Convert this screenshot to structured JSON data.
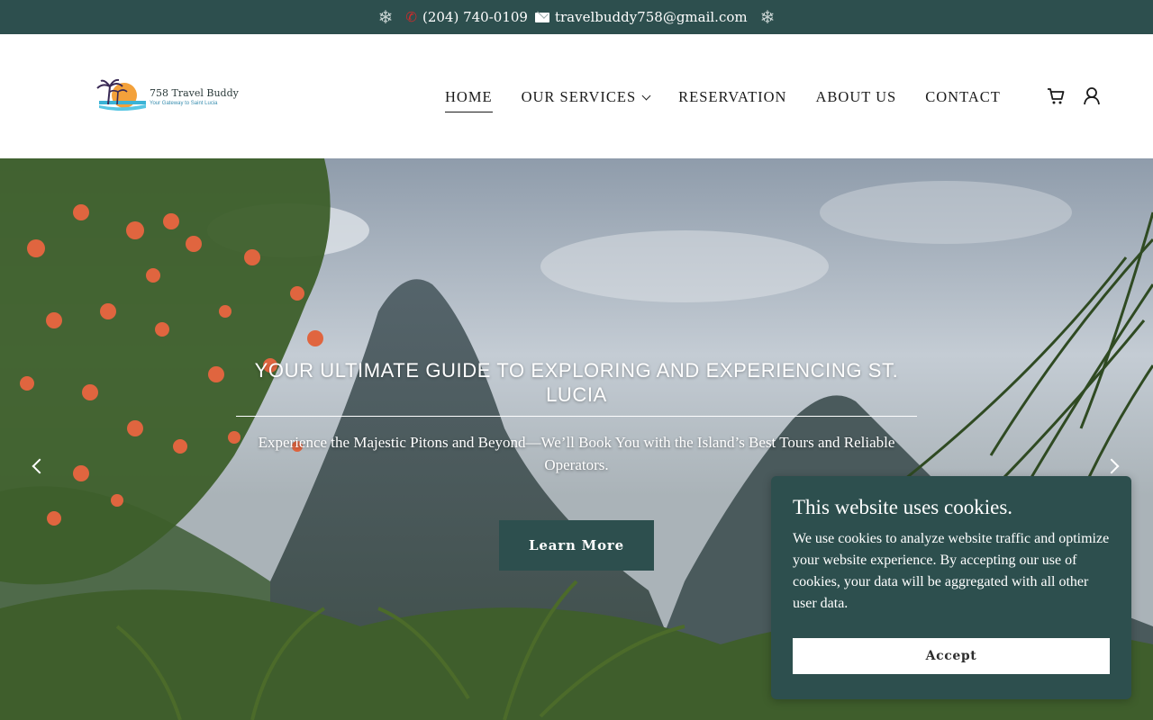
{
  "topbar": {
    "phone": "(204) 740-0109",
    "email": "travelbuddy758@gmail.com"
  },
  "logo": {
    "title": "758 Travel Buddy",
    "tagline": "Your Gateway to Saint Lucia"
  },
  "nav": {
    "items": [
      {
        "label": "HOME",
        "active": true
      },
      {
        "label": "OUR SERVICES",
        "dropdown": true
      },
      {
        "label": "RESERVATION"
      },
      {
        "label": "ABOUT US"
      },
      {
        "label": "CONTACT"
      }
    ],
    "icons": [
      "cart-icon",
      "user-icon"
    ]
  },
  "hero": {
    "title": "YOUR ULTIMATE GUIDE TO EXPLORING AND EXPERIENCING ST. LUCIA",
    "subtitle": "Experience the Majestic Pitons and Beyond—We’ll Book You with the Island’s Best Tours and Reliable Operators.",
    "button_label": "Learn More"
  },
  "cookie": {
    "title": "This website uses cookies.",
    "body": "We use cookies to analyze website traffic and optimize your website experience. By accepting our use of cookies, your data will be aggregated with all other user data.",
    "accept_label": "Accept"
  },
  "colors": {
    "brand": "#2d4f4e",
    "phone_icon": "#d32a2a"
  }
}
